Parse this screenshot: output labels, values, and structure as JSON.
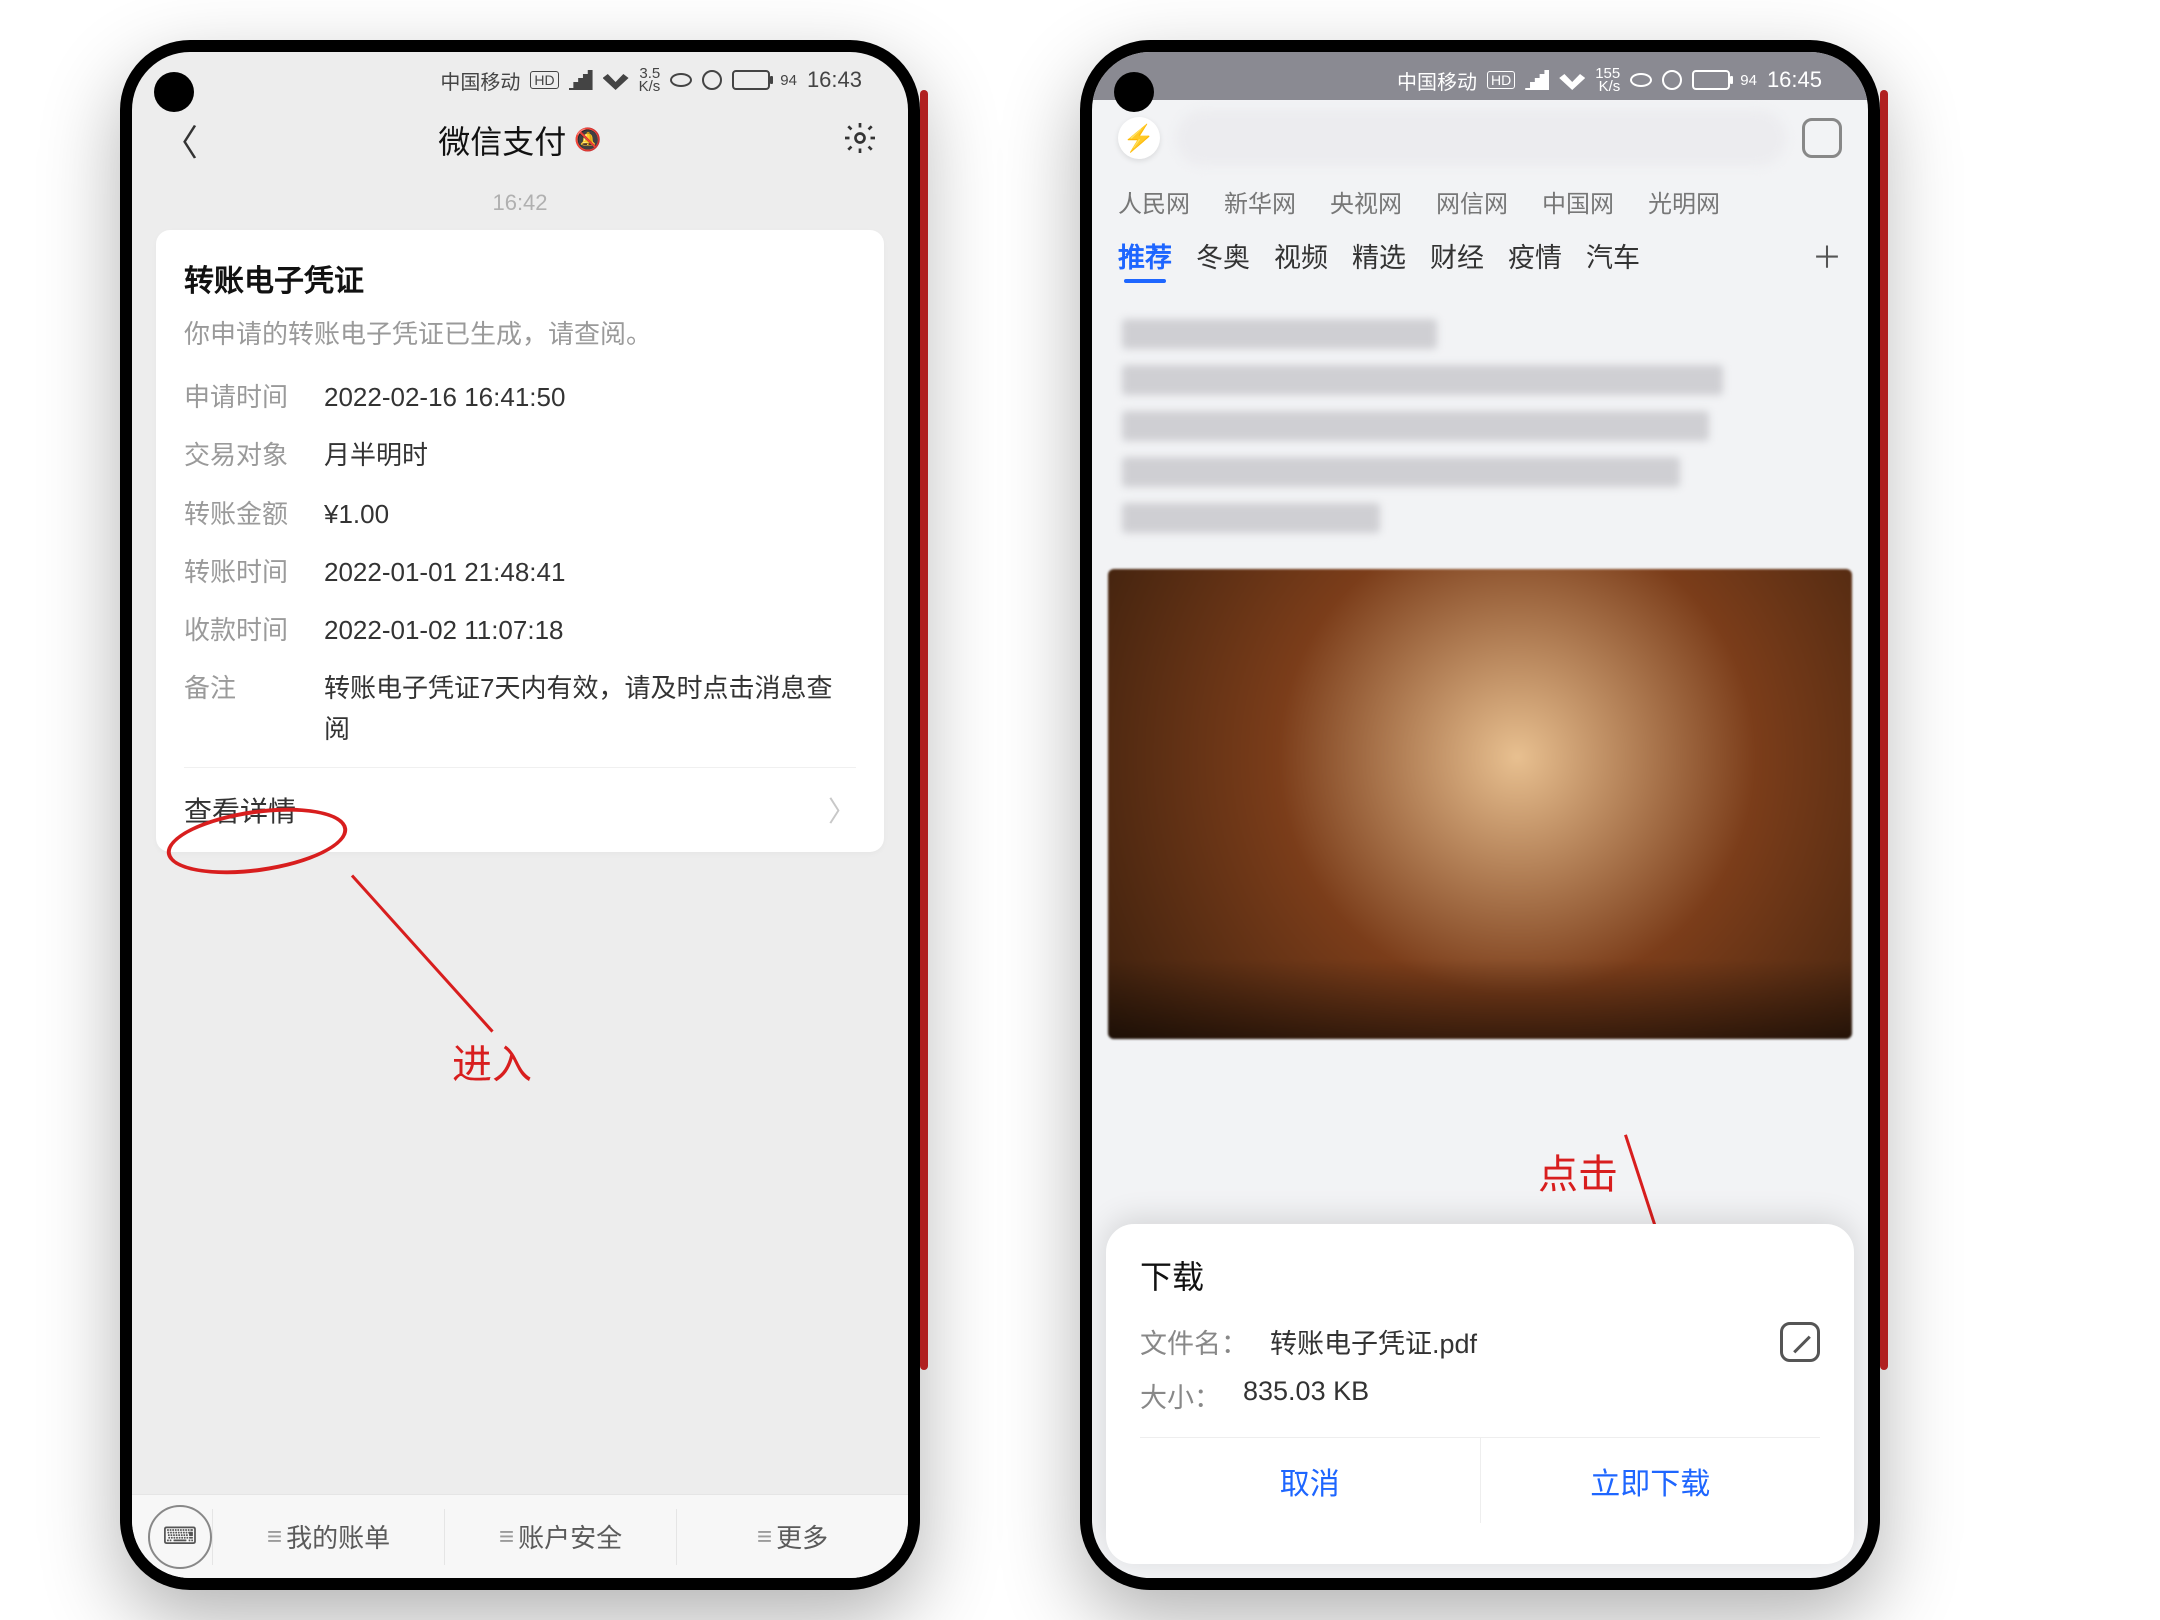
{
  "left": {
    "status": {
      "carrier": "中国移动",
      "net": "HD",
      "speed": "3.5",
      "speed_unit": "K/s",
      "battery": "94",
      "time": "16:43"
    },
    "nav": {
      "title": "微信支付",
      "muted_icon": "bell-off-icon"
    },
    "msg_time": "16:42",
    "card": {
      "title": "转账电子凭证",
      "subtitle": "你申请的转账电子凭证已生成，请查阅。",
      "rows": [
        {
          "k": "申请时间",
          "v": "2022-02-16 16:41:50"
        },
        {
          "k": "交易对象",
          "v": "月半明时"
        },
        {
          "k": "转账金额",
          "v": "¥1.00"
        },
        {
          "k": "转账时间",
          "v": "2022-01-01 21:48:41"
        },
        {
          "k": "收款时间",
          "v": "2022-01-02 11:07:18"
        },
        {
          "k": "备注",
          "v": "转账电子凭证7天内有效，请及时点击消息查阅"
        }
      ],
      "view_details": "查看详情"
    },
    "bottom": {
      "bills": "我的账单",
      "security": "账户安全",
      "more": "更多"
    },
    "annotation": "进入"
  },
  "right": {
    "status": {
      "carrier": "中国移动",
      "net": "HD",
      "speed": "155",
      "speed_unit": "K/s",
      "battery": "94",
      "time": "16:45"
    },
    "site_tabs": [
      "人民网",
      "新华网",
      "央视网",
      "网信网",
      "中国网",
      "光明网"
    ],
    "topic_tabs": [
      "推荐",
      "冬奥",
      "视频",
      "精选",
      "财经",
      "疫情",
      "汽车"
    ],
    "sheet": {
      "title": "下载",
      "filename_label": "文件名：",
      "filename": "转账电子凭证.pdf",
      "size_label": "大小：",
      "size": "835.03 KB",
      "cancel": "取消",
      "confirm": "立即下载"
    },
    "annotation": "点击"
  }
}
